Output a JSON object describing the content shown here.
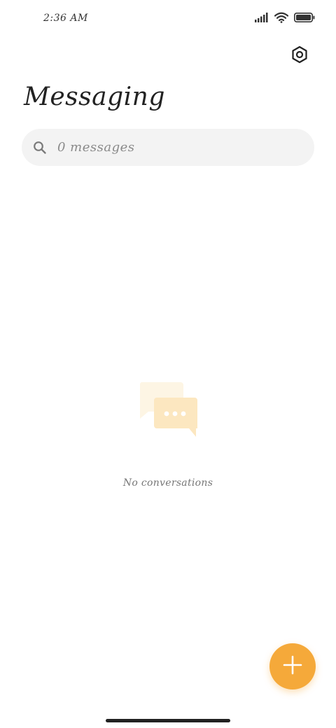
{
  "status_bar": {
    "time": "2:36 AM",
    "icons": [
      "signal-icon",
      "wifi-icon",
      "battery-icon"
    ]
  },
  "header": {
    "title": "Messaging",
    "settings_icon": "settings-icon"
  },
  "search": {
    "icon": "search-icon",
    "placeholder": "0 messages"
  },
  "empty_state": {
    "icon": "chat-bubbles-icon",
    "text": "No conversations"
  },
  "fab": {
    "icon": "plus-icon",
    "color": "#f5a93a"
  },
  "colors": {
    "accent": "#f5a93a",
    "illustration_light": "#fdf3de",
    "illustration_mid": "#fbe5bb"
  }
}
